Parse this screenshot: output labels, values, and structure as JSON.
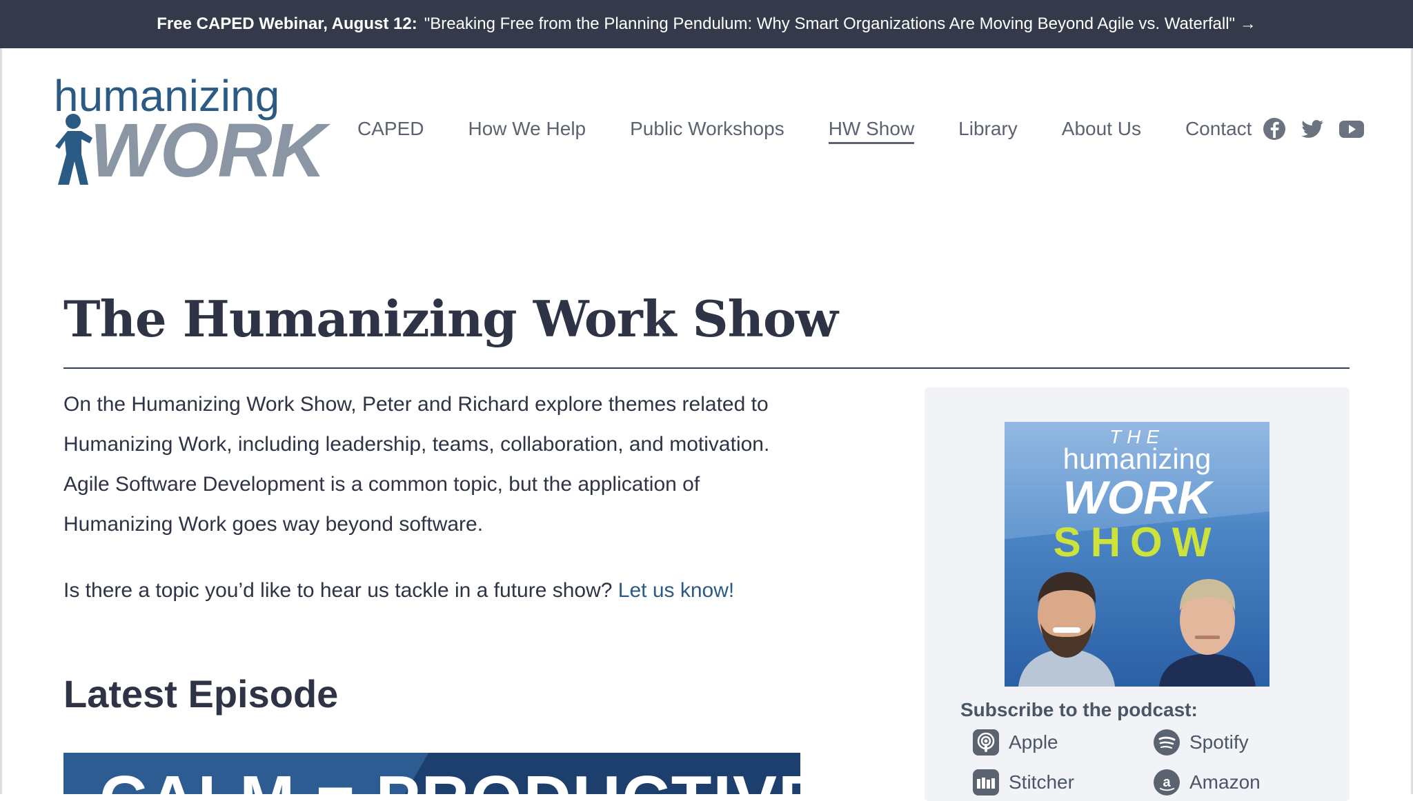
{
  "banner": {
    "bold": "Free CAPED Webinar, August 12:",
    "text": "\"Breaking Free from the Planning Pendulum: Why Smart Organizations Are Moving Beyond Agile vs. Waterfall\" →"
  },
  "logo": {
    "top": "humanizing",
    "bottom": "WORK"
  },
  "nav": {
    "items": [
      "CAPED",
      "How We Help",
      "Public Workshops",
      "HW Show",
      "Library",
      "About Us",
      "Contact"
    ],
    "active": "HW Show"
  },
  "social": [
    "facebook-icon",
    "twitter-icon",
    "youtube-icon"
  ],
  "main": {
    "title": "The Humanizing Work Show",
    "intro": "On the Humanizing Work Show, Peter and Richard explore themes related to Humanizing Work, including leadership, teams, collaboration, and motivation. Agile Software Development is a common topic, but the application of Humanizing Work goes way beyond software.",
    "question": "Is there a topic you’d like to hear us tackle in a future show?",
    "question_link": "Let us know!",
    "latest_heading": "Latest Episode",
    "episode_title": "CALM = PRODUCTIVE?"
  },
  "sidebar": {
    "cover": {
      "the": "THE",
      "humanizing": "humanizing",
      "work": "WORK",
      "show": "SHOW"
    },
    "subscribe_label": "Subscribe to the podcast:",
    "podcasts": [
      "Apple",
      "Spotify",
      "Stitcher",
      "Amazon"
    ]
  },
  "colors": {
    "banner_bg": "#353a4b",
    "text": "#2e3445",
    "link": "#2b5b84",
    "show_accent": "#cde23a"
  }
}
